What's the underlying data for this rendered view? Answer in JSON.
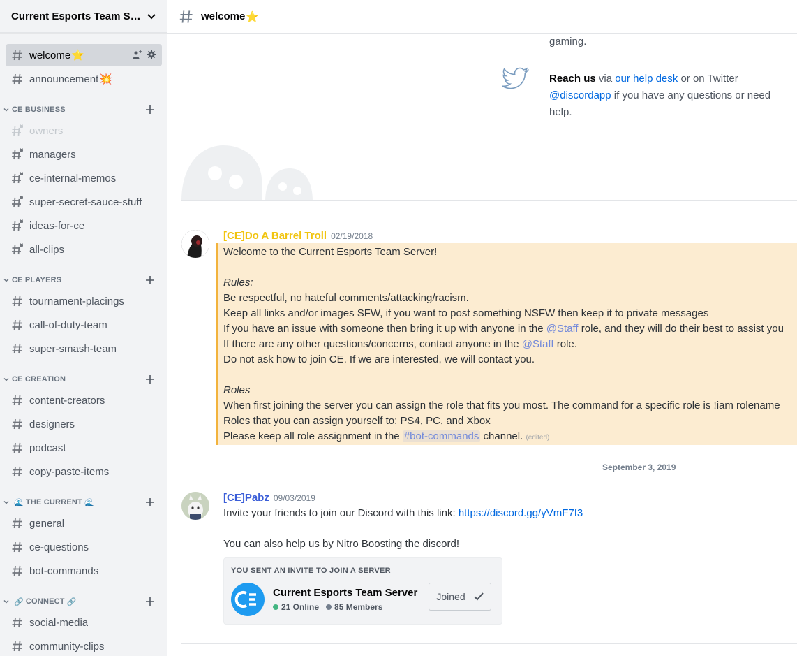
{
  "server": {
    "name": "Current Esports Team Se..."
  },
  "topbar": {
    "channel": "welcome",
    "emoji": "⭐"
  },
  "channels": {
    "top": [
      {
        "name": "welcome",
        "emoji": "⭐",
        "selected": true
      },
      {
        "name": "announcement",
        "emoji": "💥"
      }
    ],
    "categories": [
      {
        "name": "CE BUSINESS",
        "channels": [
          "owners",
          "managers",
          "ce-internal-memos",
          "super-secret-sauce-stuff",
          "ideas-for-ce",
          "all-clips"
        ]
      },
      {
        "name": "CE PLAYERS",
        "channels": [
          "tournament-placings",
          "call-of-duty-team",
          "super-smash-team"
        ]
      },
      {
        "name": "CE CREATION",
        "channels": [
          "content-creators",
          "designers",
          "podcast",
          "copy-paste-items"
        ]
      },
      {
        "name": "THE CURRENT",
        "emoji": "🌊",
        "channels": [
          "general",
          "ce-questions",
          "bot-commands"
        ]
      },
      {
        "name": "CONNECT",
        "emoji": "🔗",
        "channels": [
          "social-media",
          "community-clips"
        ]
      }
    ]
  },
  "info": {
    "gaming": "gaming.",
    "reach_bold": "Reach us",
    "via": " via ",
    "help_desk": "our help desk",
    "or_twitter": " or on Twitter",
    "handle": "@discordapp",
    "rest": " if you have any questions or need",
    "help": "help."
  },
  "messages": [
    {
      "author": "[CE]Do A Barrel Troll",
      "author_color": "#f1c40f",
      "timestamp": "02/19/2018",
      "lines": {
        "l1": "Welcome to the Current Esports Team Server!",
        "rules": "Rules:",
        "r1": "Be respectful, no hateful comments/attacking/racism.",
        "r2": "Keep all links and/or images SFW, if you want to post something NSFW then keep it to private messages",
        "r3a": "If you have an issue with someone then bring it up with anyone in the ",
        "staff": "@Staff",
        "r3b": " role, and they will do their best to assist you",
        "r4a": "If there are any other questions/concerns, contact anyone in the ",
        "r4b": " role.",
        "r5": "Do not ask how to join CE. If we are interested, we will contact you.",
        "roles": "Roles",
        "o1": "When first joining the server you can assign the role that fits you most. The command for a specific role is !iam rolename",
        "o2": "Roles that you can assign yourself to: PS4, PC, and Xbox",
        "o3a": "Please keep all role assignment in the ",
        "botcmd": "#bot-commands",
        "o3b": " channel. ",
        "edited": "(edited)"
      }
    },
    {
      "author": "[CE]Pabz",
      "author_color": "#3b5ed8",
      "timestamp": "09/03/2019",
      "lines": {
        "l1": "Invite your friends to join our Discord with this link: ",
        "link": "https://discord.gg/yVmF7f3",
        "l2": "You can also help us by Nitro Boosting the discord!"
      }
    }
  ],
  "date_divider": "September 3, 2019",
  "invite": {
    "heading": "YOU SENT AN INVITE TO JOIN A SERVER",
    "server_name": "Current Esports Team Server",
    "online": "21 Online",
    "members": "85 Members",
    "button": "Joined"
  }
}
